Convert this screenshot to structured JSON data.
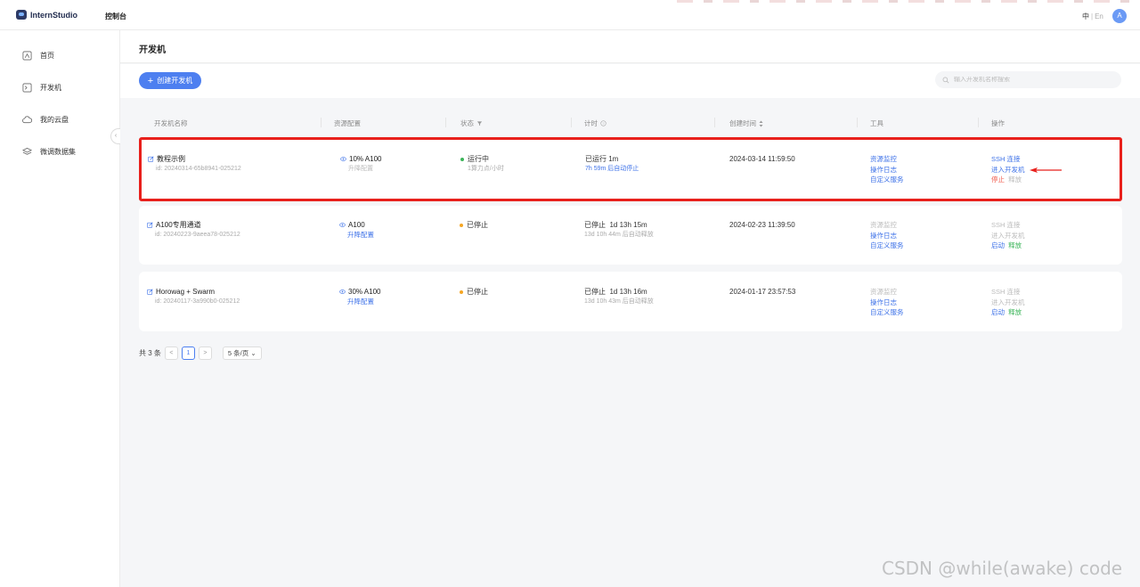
{
  "header": {
    "logo_text": "InternStudio",
    "console_label": "控制台",
    "lang_zh": "中",
    "lang_sep": "|",
    "lang_en": "En",
    "avatar_letter": "A"
  },
  "sidebar": {
    "items": [
      {
        "label": "首页",
        "icon": "home-icon"
      },
      {
        "label": "开发机",
        "icon": "terminal-icon"
      },
      {
        "label": "我的云盘",
        "icon": "cloud-icon"
      },
      {
        "label": "微调数据集",
        "icon": "layers-icon"
      }
    ],
    "collapse_glyph": "‹"
  },
  "page": {
    "title": "开发机",
    "create_button": "创建开发机",
    "search_placeholder": "输入开发机名称搜索"
  },
  "table": {
    "columns": [
      "开发机名称",
      "资源配置",
      "状态",
      "计时",
      "创建时间",
      "工具",
      "操作"
    ],
    "rows": [
      {
        "name": "教程示例",
        "id": "id: 20240314-65b8941-025212",
        "resource": "10% A100",
        "resource_action": "升降配置",
        "status": "运行中",
        "status_sub": "1算力点/小时",
        "timer": "已运行",
        "timer_value": "1m",
        "timer_sub": "7h 59m 后自动停止",
        "created": "2024-03-14 11:59:50",
        "tools": [
          "资源监控",
          "操作日志",
          "自定义服务"
        ],
        "actions": [
          "SSH 连接",
          "进入开发机",
          "停止",
          "释放"
        ]
      },
      {
        "name": "A100专用通道",
        "id": "id: 20240223-9aeea78-025212",
        "resource": "A100",
        "resource_action": "升降配置",
        "status": "已停止",
        "status_sub": "",
        "timer": "已停止",
        "timer_value": "1d 13h 15m",
        "timer_sub": "13d 10h 44m 后自动释放",
        "created": "2024-02-23 11:39:50",
        "tools": [
          "资源监控",
          "操作日志",
          "自定义服务"
        ],
        "actions": [
          "SSH 连接",
          "进入开发机",
          "启动",
          "释放"
        ]
      },
      {
        "name": "Horowag + Swarm",
        "id": "id: 20240117-3a990b0-025212",
        "resource": "30% A100",
        "resource_action": "升降配置",
        "status": "已停止",
        "status_sub": "",
        "timer": "已停止",
        "timer_value": "1d 13h 16m",
        "timer_sub": "13d 10h 43m 后自动释放",
        "created": "2024-01-17 23:57:53",
        "tools": [
          "资源监控",
          "操作日志",
          "自定义服务"
        ],
        "actions": [
          "SSH 连接",
          "进入开发机",
          "启动",
          "释放"
        ]
      }
    ]
  },
  "pagination": {
    "total": "共 3 条",
    "prev": "<",
    "current": "1",
    "next": ">",
    "page_size": "5 条/页"
  },
  "watermark": "CSDN @while(awake) code",
  "colors": {
    "accent": "#4d7ff0",
    "highlight_border": "#e8201c",
    "running": "#3cb55a",
    "stopped": "#f5a623",
    "danger": "#f05a4b"
  }
}
